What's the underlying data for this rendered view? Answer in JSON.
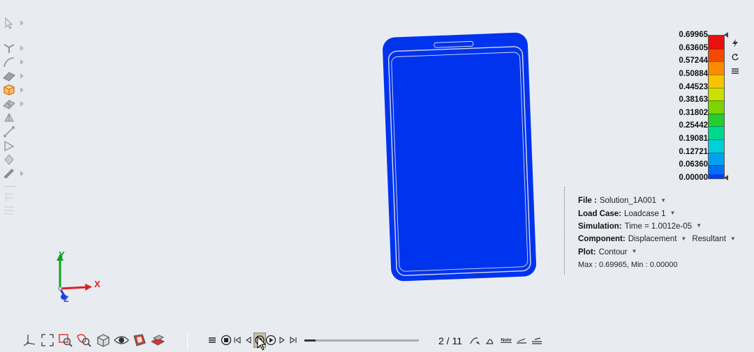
{
  "legend": {
    "values": [
      "0.69965",
      "0.63605",
      "0.57244",
      "0.50884",
      "0.44523",
      "0.38163",
      "0.31802",
      "0.25442",
      "0.19081",
      "0.12721",
      "0.06360",
      "0.00000"
    ],
    "colors": [
      "#e81010",
      "#f44a00",
      "#fb8a00",
      "#f7c400",
      "#c9e000",
      "#7ed400",
      "#27cc2d",
      "#00d88e",
      "#00d0d8",
      "#00a2ee",
      "#0070f0",
      "#0040f0"
    ]
  },
  "side_icons": [
    "lightning-icon",
    "reset-icon",
    "menu-icon"
  ],
  "info": {
    "file_label": "File :",
    "file_value": "Solution_1A001",
    "loadcase_label": "Load Case:",
    "loadcase_value": "Loadcase 1",
    "simulation_label": "Simulation:",
    "simulation_value": "Time = 1.0012e-05",
    "component_label": "Component:",
    "component_value": "Displacement",
    "component_sub": "Resultant",
    "plot_label": "Plot:",
    "plot_value": "Contour",
    "max_min": "Max : 0.69965, Min : 0.00000"
  },
  "triad": {
    "x": "X",
    "y": "Y",
    "z": "Z",
    "x_color": "#e02020",
    "y_color": "#10a020",
    "z_color": "#2040e0"
  },
  "animation": {
    "frame": "2 / 11",
    "progress": 0.1
  },
  "curve_tools": {
    "note_label": "Note"
  },
  "model": {
    "fill": "#0033ee",
    "edge": "#d8dde8"
  }
}
